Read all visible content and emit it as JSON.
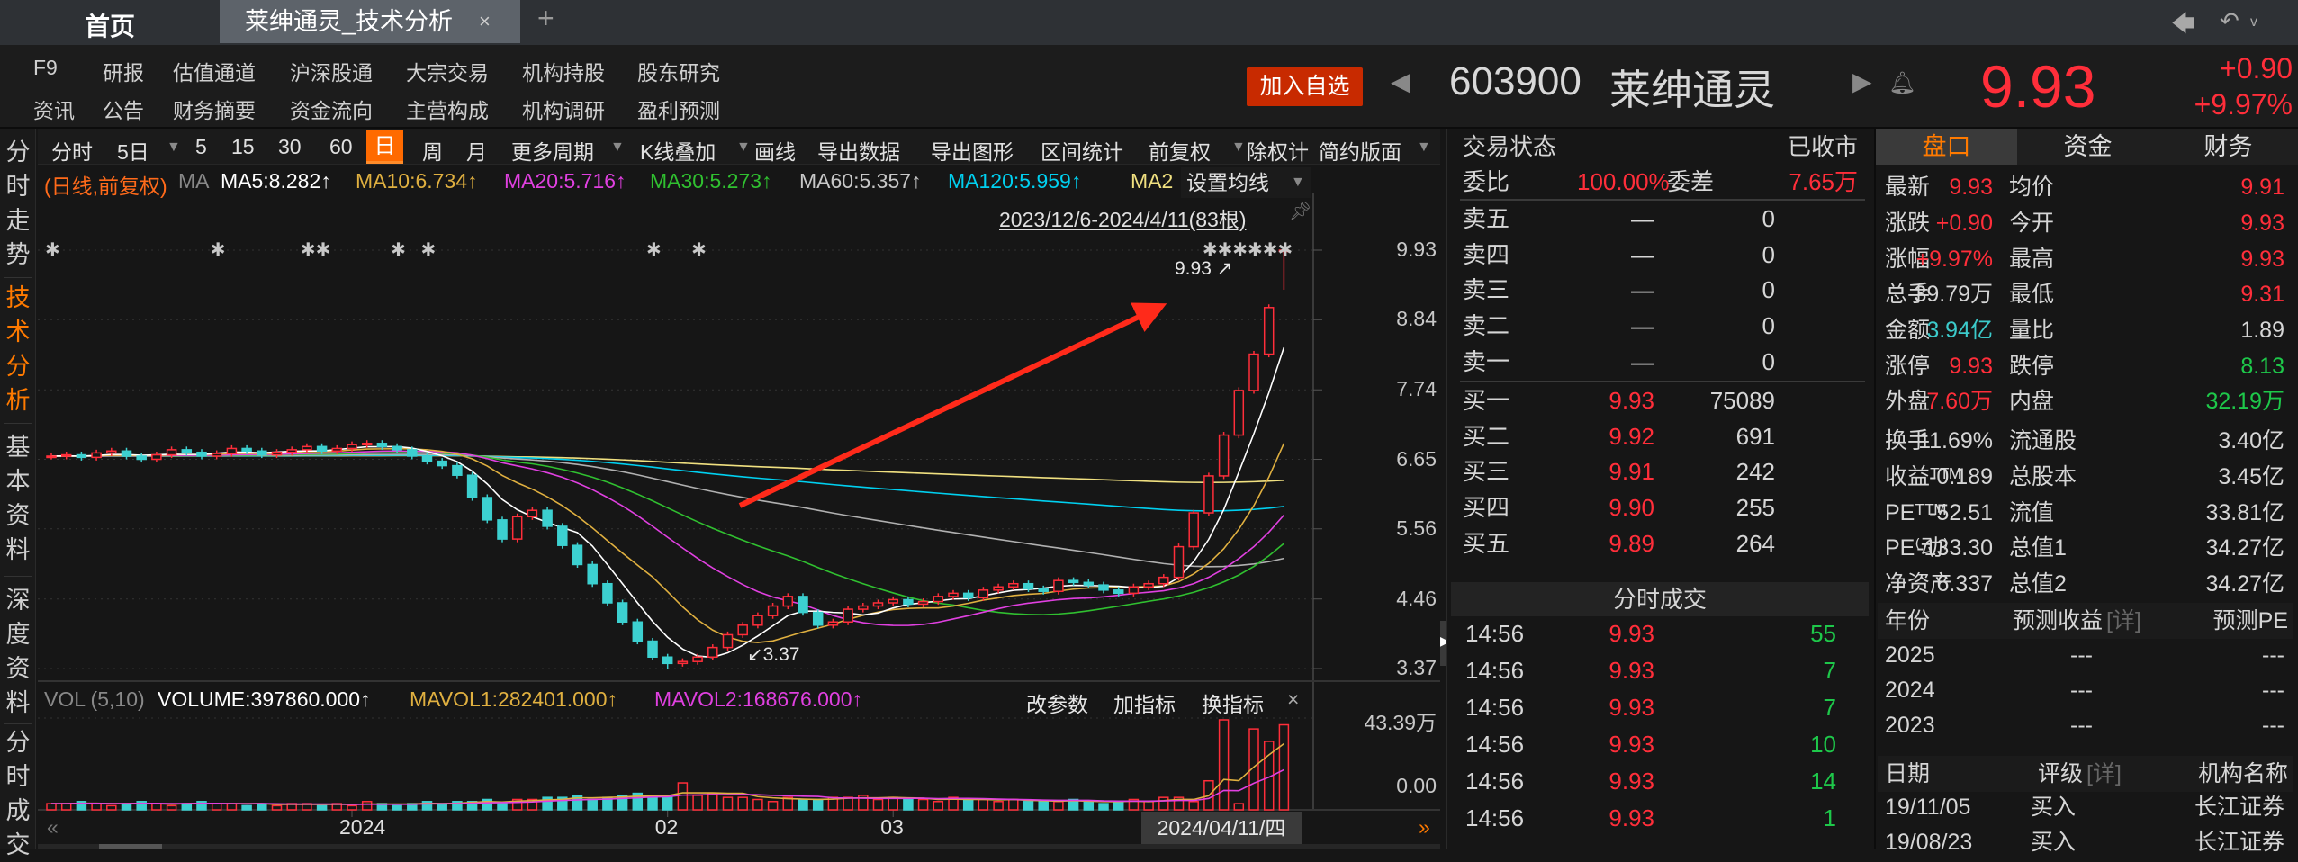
{
  "titlebar": {
    "home": "首页",
    "tab": "莱绅通灵_技术分析",
    "close": "×",
    "add": "+",
    "back_icon": "back-arrow-icon",
    "undo_icon": "undo-icon"
  },
  "nav": {
    "row1": [
      "F9",
      "研报",
      "估值通道",
      "沪深股通",
      "大宗交易",
      "机构持股",
      "股东研究"
    ],
    "row2": [
      "资讯",
      "公告",
      "财务摘要",
      "资金流向",
      "主营构成",
      "机构调研",
      "盈利预测"
    ],
    "add_watch": "加入自选"
  },
  "stock": {
    "code": "603900",
    "name": "莱绅通灵",
    "price": "9.93",
    "change": "+0.90",
    "change_pct": "+9.97%"
  },
  "sidebar": [
    "分时走势",
    "技术分析",
    "基本资料",
    "深度资料",
    "分时成交"
  ],
  "toolbar": {
    "items": [
      "分时",
      "5日",
      "5",
      "15",
      "30",
      "60",
      "日",
      "周",
      "月",
      "更多周期",
      "K线叠加",
      "画线",
      "导出数据",
      "导出图形",
      "区间统计",
      "前复权",
      "除权计",
      "简约版面"
    ],
    "dropdown": "▼"
  },
  "ma_bar": {
    "mode": "(日线,前复权)",
    "ma": "MA",
    "ma5": "MA5:8.282↑",
    "ma10": "MA10:6.734↑",
    "ma20": "MA20:5.716↑",
    "ma30": "MA30:5.273↑",
    "ma60": "MA60:5.357↑",
    "ma120": "MA120:5.959↑",
    "ma250": "MA2",
    "set_ma": "设置均线",
    "range": "2023/12/6-2024/4/11(83根)"
  },
  "volume_bar": {
    "name": "VOL (5,10)",
    "volume": "VOLUME:397860.000↑",
    "mavol1": "MAVOL1:282401.000↑",
    "mavol2": "MAVOL2:168676.000↑",
    "btn_params": "改参数",
    "btn_add": "加指标",
    "btn_switch": "换指标",
    "btn_close": "×",
    "max_label": "43.39万",
    "zero_label": "0.00"
  },
  "date_axis": {
    "left": "«",
    "right": "»",
    "current": "2024/04/11/四"
  },
  "chart_data": {
    "type": "candlestick",
    "price_ticks": [
      "9.93",
      "8.84",
      "7.74",
      "6.65",
      "5.56",
      "4.46",
      "3.37"
    ],
    "ylim": [
      3.37,
      9.93
    ],
    "closes": [
      6.7,
      6.72,
      6.68,
      6.75,
      6.78,
      6.7,
      6.65,
      6.72,
      6.8,
      6.76,
      6.7,
      6.74,
      6.82,
      6.78,
      6.72,
      6.76,
      6.8,
      6.85,
      6.78,
      6.82,
      6.88,
      6.9,
      6.85,
      6.8,
      6.7,
      6.62,
      6.55,
      6.4,
      6.05,
      5.7,
      5.4,
      5.75,
      5.85,
      5.6,
      5.3,
      5.0,
      4.7,
      4.4,
      4.1,
      3.8,
      3.55,
      3.45,
      3.48,
      3.55,
      3.7,
      3.9,
      4.05,
      4.2,
      4.35,
      4.5,
      4.25,
      4.05,
      4.1,
      4.3,
      4.35,
      4.4,
      4.45,
      4.38,
      4.42,
      4.5,
      4.55,
      4.48,
      4.6,
      4.65,
      4.7,
      4.62,
      4.58,
      4.75,
      4.72,
      4.68,
      4.6,
      4.55,
      4.65,
      4.7,
      4.8,
      5.28,
      5.81,
      6.39,
      7.03,
      7.73,
      8.3,
      9.03,
      9.93
    ],
    "volumes_wan": [
      3,
      3,
      4,
      3,
      2,
      3,
      4,
      3,
      2,
      3,
      4,
      3,
      3,
      2,
      3,
      2,
      3,
      3,
      2,
      3,
      2,
      4,
      3,
      2,
      3,
      4,
      3,
      4,
      4,
      5,
      3,
      5,
      5,
      6,
      6,
      7,
      5,
      6,
      7,
      8,
      7,
      6,
      13,
      7,
      8,
      6,
      6,
      5,
      4,
      6,
      5,
      5,
      6,
      6,
      7,
      5,
      6,
      5,
      5,
      4,
      6,
      5,
      5,
      4,
      5,
      4,
      4,
      4,
      5,
      4,
      3,
      4,
      5,
      4,
      6,
      6,
      4,
      14,
      43.39,
      3,
      39,
      33,
      41
    ],
    "volume_max": 43.39,
    "low_point": {
      "index": 41,
      "value": 3.37,
      "label": "3.37"
    },
    "high_point": {
      "index": 82,
      "value": 9.93,
      "low": 9.31,
      "label": "9.93"
    },
    "x_labels": [
      {
        "index": 20,
        "label": "2024"
      },
      {
        "index": 41,
        "label": "02"
      },
      {
        "index": 56,
        "label": "03"
      }
    ],
    "event_marker_indices": [
      0,
      11,
      17,
      18,
      23,
      25,
      40,
      43,
      77,
      78,
      79,
      80,
      81,
      82
    ],
    "ma_colors": {
      "ma5": "#ffffff",
      "ma10": "#e0b040",
      "ma20": "#e040e0",
      "ma30": "#30c030",
      "ma60": "#b0b0b0",
      "ma120": "#00d0f0",
      "ma250": "#f0e080"
    },
    "up_color": "#ff2e3a",
    "down_color": "#3cd0d0"
  },
  "orderbook": {
    "status_label": "交易状态",
    "status": "已收市",
    "ratio_label": "委比",
    "ratio": "100.00%",
    "diff_label": "委差",
    "diff": "7.65万",
    "sell": [
      {
        "label": "卖五",
        "price": "—",
        "vol": "0"
      },
      {
        "label": "卖四",
        "price": "—",
        "vol": "0"
      },
      {
        "label": "卖三",
        "price": "—",
        "vol": "0"
      },
      {
        "label": "卖二",
        "price": "—",
        "vol": "0"
      },
      {
        "label": "卖一",
        "price": "—",
        "vol": "0"
      }
    ],
    "buy": [
      {
        "label": "买一",
        "price": "9.93",
        "vol": "75089"
      },
      {
        "label": "买二",
        "price": "9.92",
        "vol": "691"
      },
      {
        "label": "买三",
        "price": "9.91",
        "vol": "242"
      },
      {
        "label": "买四",
        "price": "9.90",
        "vol": "255"
      },
      {
        "label": "买五",
        "price": "9.89",
        "vol": "264"
      }
    ]
  },
  "trades": {
    "title": "分时成交",
    "rows": [
      {
        "time": "14:56",
        "price": "9.93",
        "vol": "55"
      },
      {
        "time": "14:56",
        "price": "9.93",
        "vol": "7"
      },
      {
        "time": "14:56",
        "price": "9.93",
        "vol": "7"
      },
      {
        "time": "14:56",
        "price": "9.93",
        "vol": "10"
      },
      {
        "time": "14:56",
        "price": "9.93",
        "vol": "14"
      },
      {
        "time": "14:56",
        "price": "9.93",
        "vol": "1"
      }
    ]
  },
  "quote": {
    "tabs": [
      "盘口",
      "资金",
      "财务"
    ],
    "rows": [
      {
        "l1": "最新",
        "v1": "9.93",
        "c1": "red",
        "l2": "均价",
        "v2": "9.91",
        "c2": "red"
      },
      {
        "l1": "涨跌",
        "v1": "+0.90",
        "c1": "red",
        "l2": "今开",
        "v2": "9.93",
        "c2": "red"
      },
      {
        "l1": "涨幅",
        "v1": "+9.97%",
        "c1": "red",
        "l2": "最高",
        "v2": "9.93",
        "c2": "red"
      },
      {
        "l1": "总手",
        "v1": "39.79万",
        "c1": "white",
        "l2": "最低",
        "v2": "9.31",
        "c2": "red"
      },
      {
        "l1": "金额",
        "v1": "3.94亿",
        "c1": "cyan",
        "l2": "量比",
        "v2": "1.89",
        "c2": "white"
      },
      {
        "l1": "涨停",
        "v1": "9.93",
        "c1": "red",
        "l2": "跌停",
        "v2": "8.13",
        "c2": "green"
      },
      {
        "l1": "外盘",
        "v1": "7.60万",
        "c1": "red",
        "l2": "内盘",
        "v2": "32.19万",
        "c2": "green"
      },
      {
        "l1": "换手",
        "v1": "11.69%",
        "c1": "white",
        "l2": "流通股",
        "v2": "3.40亿",
        "c2": "white"
      },
      {
        "l1": "收益ᵀᵀᴹ",
        "v1": "-0.189",
        "c1": "white",
        "l2": "总股本",
        "v2": "3.45亿",
        "c2": "white"
      },
      {
        "l1": "PEᵀᵀᴹ",
        "v1": "-52.51",
        "c1": "white",
        "l2": "流值",
        "v2": "33.81亿",
        "c2": "white"
      },
      {
        "l1": "PE⁽动⁾",
        "v1": "-133.30",
        "c1": "white",
        "l2": "总值1",
        "v2": "34.27亿",
        "c2": "white"
      },
      {
        "l1": "净资产",
        "v1": "6.337",
        "c1": "white",
        "l2": "总值2",
        "v2": "34.27亿",
        "c2": "white"
      }
    ]
  },
  "forecast": {
    "h_year": "年份",
    "h_eps": "预测收益",
    "h_detail": "[详]",
    "h_pe": "预测PE",
    "rows": [
      {
        "year": "2025",
        "eps": "---",
        "pe": "---"
      },
      {
        "year": "2024",
        "eps": "---",
        "pe": "---"
      },
      {
        "year": "2023",
        "eps": "---",
        "pe": "---"
      }
    ]
  },
  "ratings": {
    "h_date": "日期",
    "h_rating": "评级",
    "h_detail": "[详]",
    "h_org": "机构名称",
    "rows": [
      {
        "date": "19/11/05",
        "rating": "买入",
        "org": "长江证券"
      },
      {
        "date": "19/08/23",
        "rating": "买入",
        "org": "长江证券"
      }
    ]
  }
}
